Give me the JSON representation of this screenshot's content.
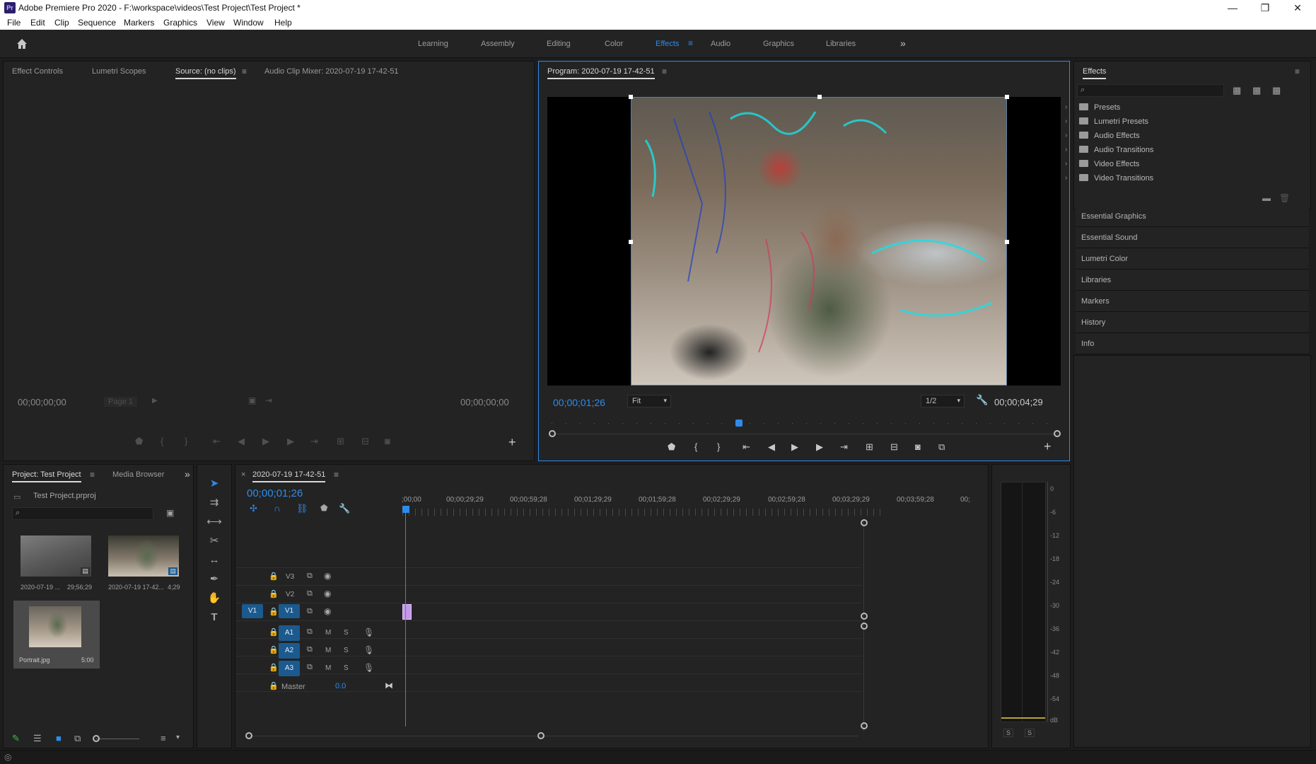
{
  "app": {
    "title": "Adobe Premiere Pro 2020 - F:\\workspace\\videos\\Test Project\\Test Project *",
    "logo_text": "Pr",
    "window_controls": {
      "minimize": "—",
      "restore": "❐",
      "close": "✕"
    }
  },
  "menu": [
    "File",
    "Edit",
    "Clip",
    "Sequence",
    "Markers",
    "Graphics",
    "View",
    "Window",
    "Help"
  ],
  "workspaces": {
    "items": [
      "Learning",
      "Assembly",
      "Editing",
      "Color",
      "Effects",
      "Audio",
      "Graphics",
      "Libraries"
    ],
    "active": "Effects",
    "more_icon": "double-chevron-right-icon"
  },
  "source_panel": {
    "tabs": [
      "Effect Controls",
      "Lumetri Scopes",
      "Source: (no clips)",
      "Audio Clip Mixer: 2020-07-19 17-42-51"
    ],
    "active_tab": "Source: (no clips)",
    "timecode_left": "00;00;00;00",
    "page_select": "Page 1",
    "timecode_right": "00;00;00;00"
  },
  "program_panel": {
    "title": "Program: 2020-07-19 17-42-51",
    "timecode_current": "00;00;01;26",
    "zoom": "Fit",
    "resolution": "1/2",
    "timecode_duration": "00;00;04;29",
    "playhead_fraction": 0.37
  },
  "effects_panel": {
    "title": "Effects",
    "search_placeholder": "",
    "folders": [
      "Presets",
      "Lumetri Presets",
      "Audio Effects",
      "Audio Transitions",
      "Video Effects",
      "Video Transitions"
    ]
  },
  "side_panels": [
    "Essential Graphics",
    "Essential Sound",
    "Lumetri Color",
    "Libraries",
    "Markers",
    "History",
    "Info"
  ],
  "project_panel": {
    "tabs": [
      "Project: Test Project",
      "Media Browser"
    ],
    "active_tab": "Project: Test Project",
    "project_file": "Test Project.prproj",
    "items": [
      {
        "name": "2020-07-19 ...",
        "duration": "29;56;29"
      },
      {
        "name": "2020-07-19 17-42...",
        "duration": "4;29"
      },
      {
        "name": "Portrait.jpg",
        "duration": "5:00"
      }
    ]
  },
  "timeline": {
    "sequence_name": "2020-07-19 17-42-51",
    "timecode": "00;00;01;26",
    "ruler": [
      ";00;00",
      "00;00;29;29",
      "00;00;59;28",
      "00;01;29;29",
      "00;01;59;28",
      "00;02;29;29",
      "00;02;59;28",
      "00;03;29;29",
      "00;03;59;28",
      "00;"
    ],
    "video_tracks": [
      "V3",
      "V2",
      "V1"
    ],
    "source_patch": "V1",
    "audio_tracks": [
      "A1",
      "A2",
      "A3"
    ],
    "audio_btn_m": "M",
    "audio_btn_s": "S",
    "master_label": "Master",
    "master_value": "0.0"
  },
  "audio_meter": {
    "scale": [
      "0",
      "-6",
      "-12",
      "-18",
      "-24",
      "-30",
      "-36",
      "-42",
      "-48",
      "-54",
      "dB"
    ],
    "solo_left": "S",
    "solo_right": "S"
  },
  "colors": {
    "accent": "#2d8ceb",
    "panel_bg": "#232323",
    "track_blue": "#1c5a8e"
  }
}
